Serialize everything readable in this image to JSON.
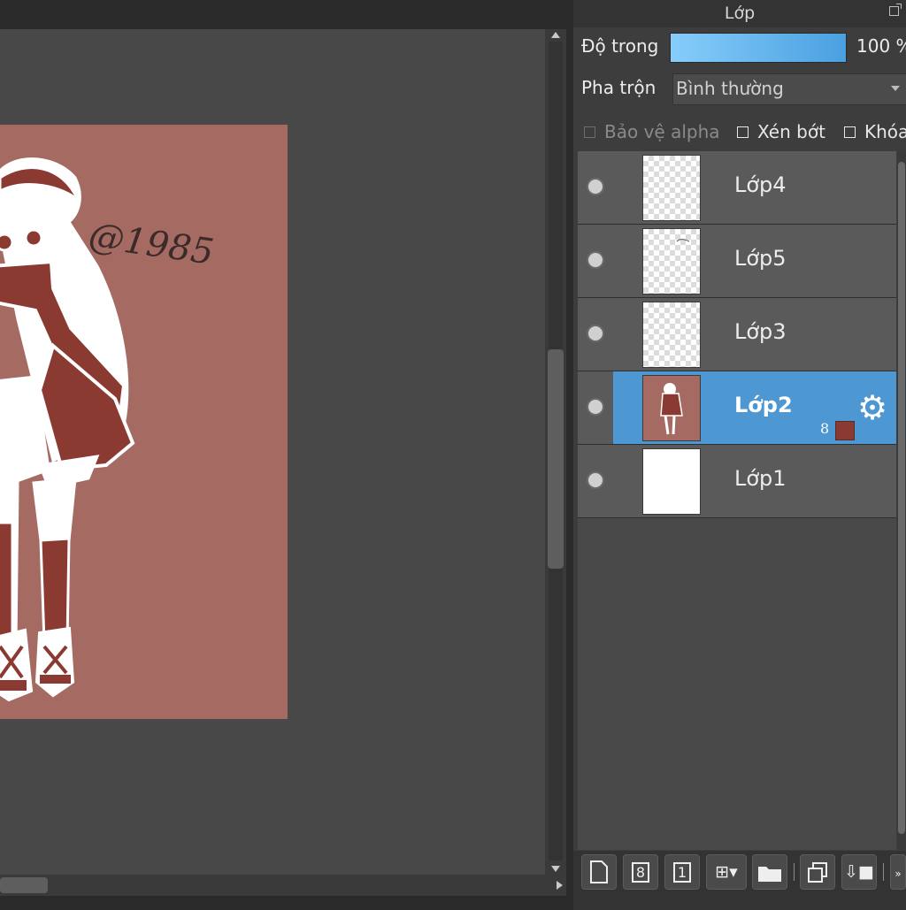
{
  "canvas": {
    "signature_text": "@1985",
    "artboard_color": "#a56a62"
  },
  "layer_panel": {
    "title": "Lớp",
    "opacity_label": "Độ trong",
    "opacity_value": "100 %",
    "opacity_percent": 100,
    "blend_label": "Pha trộn",
    "blend_value": "Bình thường",
    "checkboxes": {
      "protect_alpha": "Bảo vệ alpha",
      "clipping": "Xén bớt",
      "lock": "Khóa"
    },
    "layers": [
      {
        "name": "Lớp4",
        "selected": false
      },
      {
        "name": "Lớp5",
        "selected": false
      },
      {
        "name": "Lớp3",
        "selected": false
      },
      {
        "name": "Lớp2",
        "selected": true,
        "bit_depth": "8",
        "layer_color": "#8a3a31"
      },
      {
        "name": "Lớp1",
        "selected": false
      }
    ],
    "toolbar_labels": {
      "bit8": "8",
      "bit1": "1"
    },
    "accent_color": "#4d97d2"
  }
}
